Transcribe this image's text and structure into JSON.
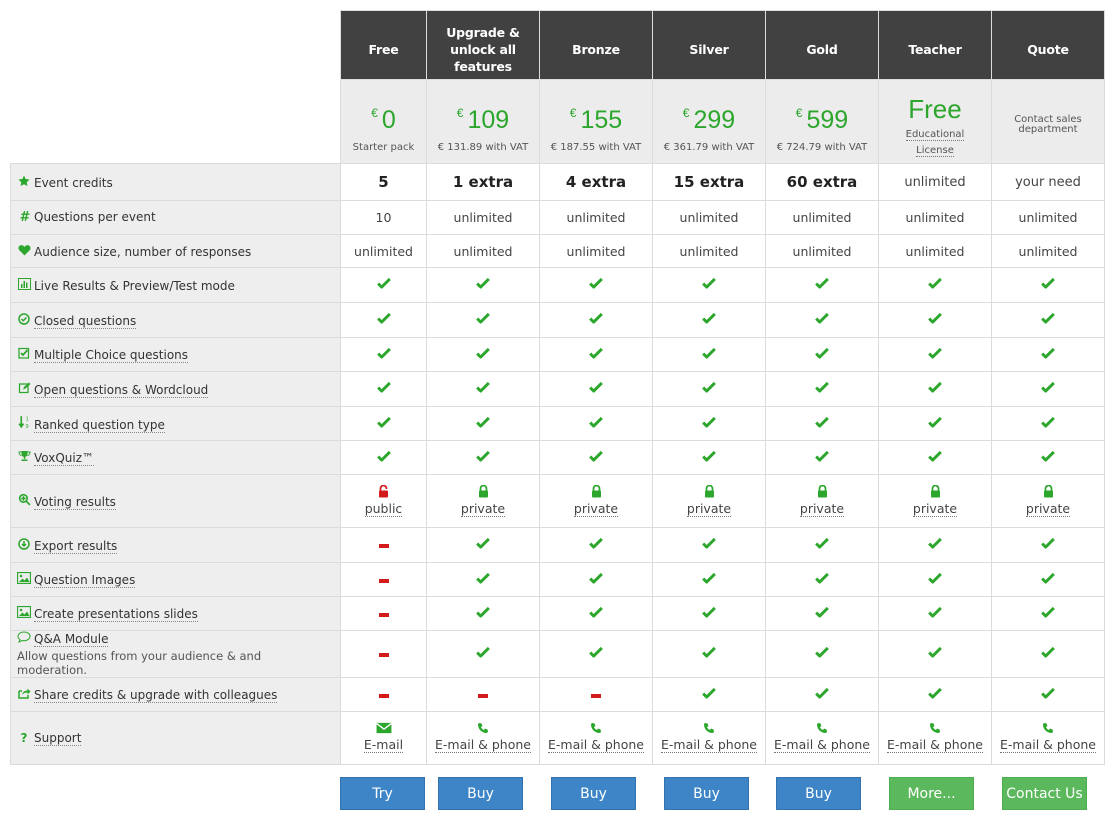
{
  "plans": [
    {
      "name": "Free",
      "price": "0",
      "currency": "€",
      "sub": "Starter pack"
    },
    {
      "name": "Upgrade & unlock all features",
      "price": "109",
      "currency": "€",
      "sub": "€ 131.89 with VAT"
    },
    {
      "name": "Bronze",
      "price": "155",
      "currency": "€",
      "sub": "€ 187.55 with VAT"
    },
    {
      "name": "Silver",
      "price": "299",
      "currency": "€",
      "sub": "€ 361.79 with VAT"
    },
    {
      "name": "Gold",
      "price": "599",
      "currency": "€",
      "sub": "€ 724.79 with VAT"
    },
    {
      "name": "Teacher",
      "price_text": "Free",
      "sub_line1": "Educational",
      "sub_line2": "License"
    },
    {
      "name": "Quote",
      "note": "Contact sales department"
    }
  ],
  "features": [
    {
      "label": "Event credits",
      "icon": "star-icon",
      "values": [
        "5",
        "1 extra",
        "4 extra",
        "15 extra",
        "60 extra",
        "unlimited",
        "your need"
      ]
    },
    {
      "label": "Questions per event",
      "icon": "hashtag-icon",
      "values": [
        "10",
        "unlimited",
        "unlimited",
        "unlimited",
        "unlimited",
        "unlimited",
        "unlimited"
      ]
    },
    {
      "label": "Audience size, number of responses",
      "icon": "heart-icon",
      "values": [
        "unlimited",
        "unlimited",
        "unlimited",
        "unlimited",
        "unlimited",
        "unlimited",
        "unlimited"
      ]
    },
    {
      "label": "Live Results & Preview/Test mode",
      "icon": "bar-chart-icon",
      "values": [
        "yes",
        "yes",
        "yes",
        "yes",
        "yes",
        "yes",
        "yes"
      ]
    },
    {
      "label": "Closed questions",
      "icon": "check-circle-icon",
      "values": [
        "yes",
        "yes",
        "yes",
        "yes",
        "yes",
        "yes",
        "yes"
      ]
    },
    {
      "label": "Multiple Choice questions",
      "icon": "check-square-icon",
      "values": [
        "yes",
        "yes",
        "yes",
        "yes",
        "yes",
        "yes",
        "yes"
      ]
    },
    {
      "label": "Open questions & Wordcloud",
      "icon": "edit-icon",
      "values": [
        "yes",
        "yes",
        "yes",
        "yes",
        "yes",
        "yes",
        "yes"
      ]
    },
    {
      "label": "Ranked question type",
      "icon": "sort-numeric-icon",
      "values": [
        "yes",
        "yes",
        "yes",
        "yes",
        "yes",
        "yes",
        "yes"
      ]
    },
    {
      "label": "VoxQuiz™",
      "icon": "trophy-icon",
      "values": [
        "yes",
        "yes",
        "yes",
        "yes",
        "yes",
        "yes",
        "yes"
      ]
    },
    {
      "label": "Voting results",
      "icon": "zoom-in-icon",
      "values": [
        "public",
        "private",
        "private",
        "private",
        "private",
        "private",
        "private"
      ]
    },
    {
      "label": "Export results",
      "icon": "download-circle-icon",
      "values": [
        "no",
        "yes",
        "yes",
        "yes",
        "yes",
        "yes",
        "yes"
      ]
    },
    {
      "label": "Question Images",
      "icon": "image-icon",
      "values": [
        "no",
        "yes",
        "yes",
        "yes",
        "yes",
        "yes",
        "yes"
      ]
    },
    {
      "label": "Create presentations slides",
      "icon": "image-icon",
      "values": [
        "no",
        "yes",
        "yes",
        "yes",
        "yes",
        "yes",
        "yes"
      ]
    },
    {
      "label": "Q&A Module",
      "sub": "Allow questions from your audience & and moderation.",
      "icon": "comment-icon",
      "values": [
        "no",
        "yes",
        "yes",
        "yes",
        "yes",
        "yes",
        "yes"
      ]
    },
    {
      "label": "Share credits & upgrade with colleagues",
      "icon": "share-icon",
      "values": [
        "no",
        "no",
        "no",
        "yes",
        "yes",
        "yes",
        "yes"
      ]
    },
    {
      "label": "Support",
      "icon": "question-icon",
      "values": [
        "E-mail",
        "E-mail & phone",
        "E-mail & phone",
        "E-mail & phone",
        "E-mail & phone",
        "E-mail & phone",
        "E-mail & phone"
      ]
    }
  ],
  "buttons": [
    {
      "label": "Try",
      "style": "blue"
    },
    {
      "label": "Buy",
      "style": "blue"
    },
    {
      "label": "Buy",
      "style": "blue"
    },
    {
      "label": "Buy",
      "style": "blue"
    },
    {
      "label": "Buy",
      "style": "blue"
    },
    {
      "label": "More...",
      "style": "green"
    },
    {
      "label": "Contact Us",
      "style": "green"
    }
  ],
  "colors": {
    "accent_green": "#2ca62c",
    "header_dark": "#414141",
    "no_red": "#d41b1b",
    "button_blue": "#3d85c6",
    "button_green": "#5cb85c"
  }
}
